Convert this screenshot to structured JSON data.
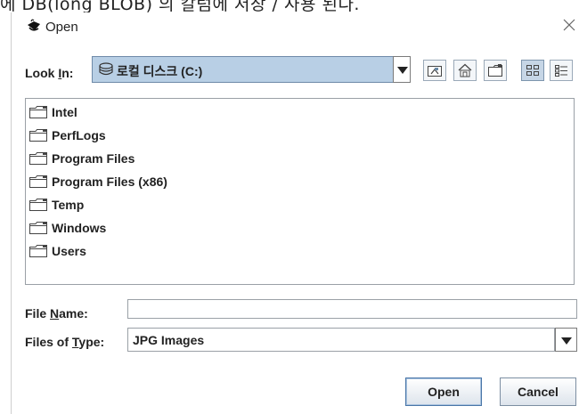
{
  "background_text": "에 DB(long BLOB) 의 칼럼에 저장 / 사용 된다.",
  "window": {
    "title": "Open"
  },
  "look_in": {
    "label_pre": "Look ",
    "label_mnemonic": "I",
    "label_post": "n:",
    "value": "로컬 디스크 (C:)"
  },
  "toolbar": {
    "up_one_level": "up-folder-icon",
    "home": "home-icon",
    "new_folder": "new-folder-icon",
    "list_view": "list-view-icon",
    "details_view": "details-view-icon"
  },
  "files": [
    {
      "name": "Intel"
    },
    {
      "name": "PerfLogs"
    },
    {
      "name": "Program Files"
    },
    {
      "name": "Program Files (x86)"
    },
    {
      "name": "Temp"
    },
    {
      "name": "Windows"
    },
    {
      "name": "Users"
    }
  ],
  "file_name": {
    "label_pre": "File ",
    "label_mnemonic": "N",
    "label_post": "ame:",
    "value": ""
  },
  "file_type": {
    "label_pre": "Files of ",
    "label_mnemonic": "T",
    "label_post": "ype:",
    "value": "JPG Images"
  },
  "buttons": {
    "open": "Open",
    "cancel": "Cancel"
  }
}
